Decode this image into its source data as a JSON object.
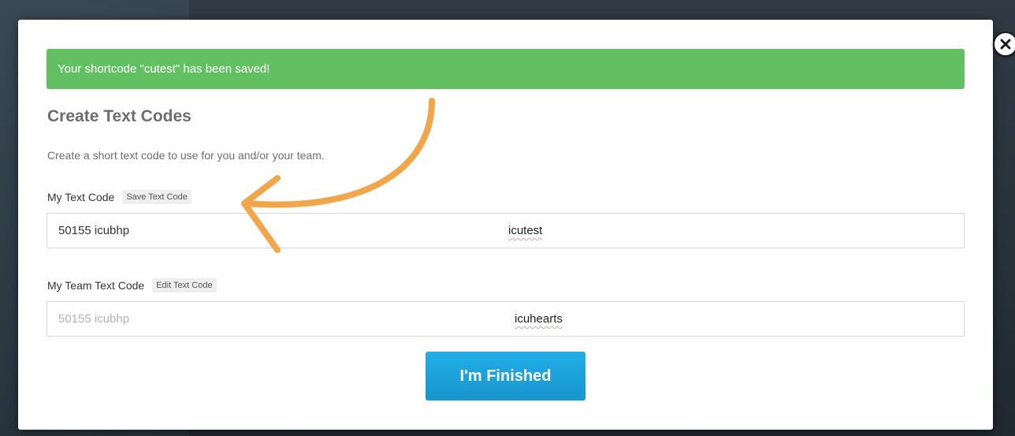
{
  "alert": {
    "message": "Your shortcode \"cutest\" has been saved!"
  },
  "page": {
    "title": "Create Text Codes",
    "description": "Create a short text code to use for you and/or your team."
  },
  "my_code": {
    "label": "My Text Code",
    "action_label": "Save Text Code",
    "prefix": "50155 icubhp",
    "value": "icutest"
  },
  "team_code": {
    "label": "My Team Text Code",
    "action_label": "Edit Text Code",
    "prefix": "50155 icubhp",
    "value": "icuhearts"
  },
  "finish_button": {
    "label": "I'm Finished"
  },
  "colors": {
    "alert_bg": "#62c063",
    "button_blue": "#1ea4de",
    "annotation_arrow": "#f2a64a"
  },
  "icons": {
    "close": "close-icon",
    "annotation": "curved-arrow-icon"
  }
}
